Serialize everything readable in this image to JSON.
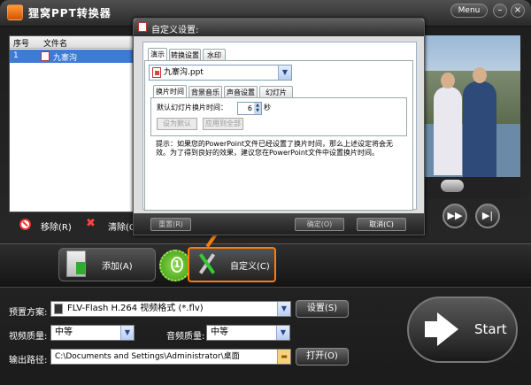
{
  "app": {
    "title": "狸窝PPT转换器",
    "menu_label": "Menu",
    "minimize": "–",
    "close": "×"
  },
  "file_list": {
    "columns": [
      "序号",
      "文件名"
    ],
    "rows": [
      {
        "index": "1",
        "name": "九寨沟"
      }
    ]
  },
  "list_actions": {
    "remove": "移除(R)",
    "clear": "清除(C"
  },
  "player": {
    "fast_forward": "▶▶",
    "next": "▶|"
  },
  "main": {
    "add": "添加(A)",
    "custom": "自定义(C)",
    "step_number": "1",
    "start": "Start"
  },
  "form": {
    "preset_label": "预置方案:",
    "preset_value": "FLV-Flash H.264 视频格式 (*.flv)",
    "settings": "设置(S)",
    "video_quality_label": "视频质量:",
    "video_quality_value": "中等",
    "audio_quality_label": "音频质量:",
    "audio_quality_value": "中等",
    "output_label": "输出路径:",
    "output_value": "C:\\Documents and Settings\\Administrator\\桌面",
    "open": "打开(O)"
  },
  "dialog": {
    "title": "自定义设置:",
    "tabs": [
      "演示",
      "转换设置",
      "水印"
    ],
    "file_value": "九寨沟.ppt",
    "subtabs": [
      "换片时间",
      "背景音乐",
      "声音设置",
      "幻灯片"
    ],
    "default_time_label": "默认幻灯片换片时间：",
    "default_time_value": "6",
    "seconds": "秒",
    "set_default": "设为默认",
    "apply_all": "应用到全部",
    "hint": "提示：如果您的PowerPoint文件已经设置了换片时间，那么上述设定将会无效。为了得到良好的效果，建议您在PowerPoint文件中设置换片时间。",
    "reset": "重置(R)",
    "ok": "确定(O)",
    "cancel": "取消(C)"
  },
  "colors": {
    "highlight": "#f07d10",
    "selection": "#3d7bd6"
  }
}
